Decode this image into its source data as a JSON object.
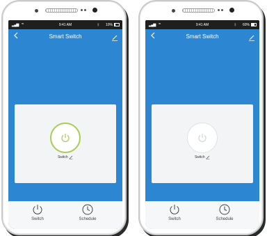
{
  "screens": [
    {
      "state": "on",
      "status": {
        "time": "9:41 AM",
        "battery": "10%"
      },
      "nav": {
        "title": "Smart Switch"
      },
      "device": {
        "label": "Switch"
      },
      "tabs": [
        {
          "label": "Switch"
        },
        {
          "label": "Schedule"
        }
      ]
    },
    {
      "state": "off",
      "status": {
        "time": "9:41 AM",
        "battery": "60%"
      },
      "nav": {
        "title": "Smart Switch"
      },
      "device": {
        "label": "Switch"
      },
      "tabs": [
        {
          "label": "Switch"
        },
        {
          "label": "Schedule"
        }
      ]
    }
  ],
  "colors": {
    "primary_blue": "#2d86d2",
    "power_on_ring": "#a9cc52",
    "power_on_icon": "#a9cc52",
    "power_off_icon": "#cfd6dc",
    "card_bg": "#f3f4f6",
    "status_bar": "#1f1f1f"
  },
  "icons": {
    "back": "chevron-left-icon",
    "edit": "pencil-icon",
    "power": "power-icon",
    "switch_tab": "power-icon",
    "schedule_tab": "clock-icon"
  }
}
